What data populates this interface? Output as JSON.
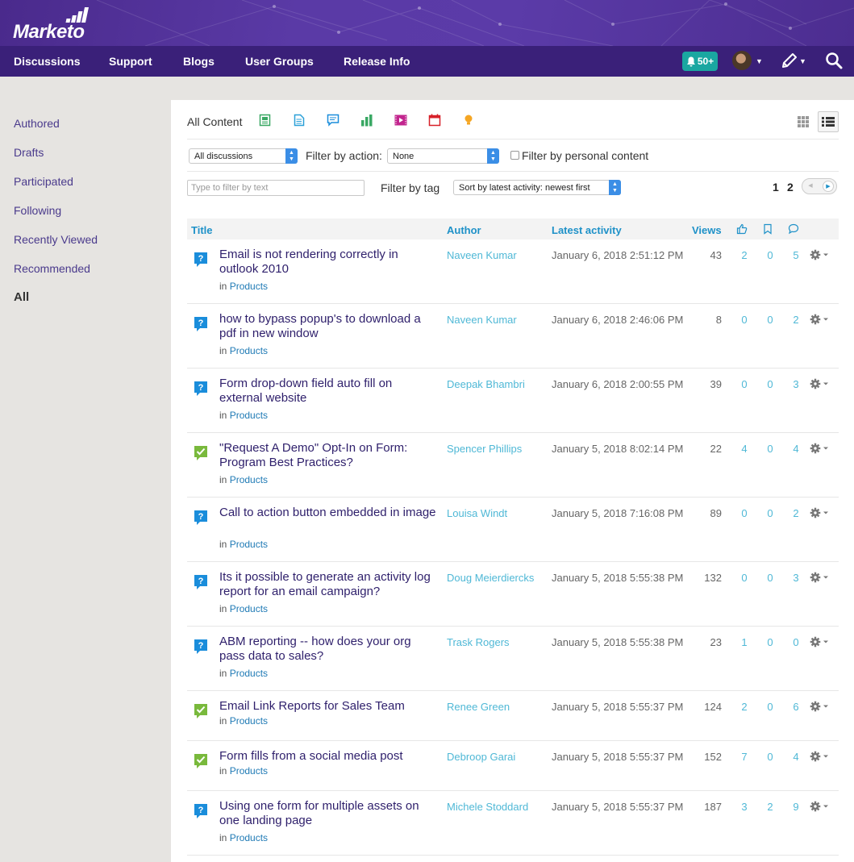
{
  "brand": {
    "logo_text": "Marketo"
  },
  "nav": {
    "items": [
      "Discussions",
      "Support",
      "Blogs",
      "User Groups",
      "Release Info"
    ],
    "notifications": "50+"
  },
  "sidebar": {
    "items": [
      "Authored",
      "Drafts",
      "Participated",
      "Following",
      "Recently Viewed",
      "Recommended",
      "All"
    ],
    "active": "All"
  },
  "content": {
    "label": "All Content",
    "type_icons": [
      "document-icon",
      "file-icon",
      "discussion-icon",
      "poll-icon",
      "video-icon",
      "event-icon",
      "idea-icon"
    ]
  },
  "filters": {
    "discussions_select": "All discussions",
    "action_label": "Filter by action:",
    "action_select": "None",
    "personal_label": "Filter by personal content",
    "text_placeholder": "Type to filter by text",
    "tag_label": "Filter by tag",
    "sort_select": "Sort by latest activity: newest first"
  },
  "pager": {
    "pages": [
      "1",
      "2"
    ]
  },
  "table": {
    "headers": {
      "title": "Title",
      "author": "Author",
      "latest": "Latest activity",
      "views": "Views"
    },
    "rows": [
      {
        "type": "question",
        "title": "Email is not rendering correctly in outlook 2010",
        "place": "Products",
        "author": "Naveen Kumar",
        "latest": "January 6, 2018 2:51:12 PM",
        "views": "43",
        "likes": "2",
        "bookmarks": "0",
        "replies": "5"
      },
      {
        "type": "question",
        "title": "how to bypass popup's to download a pdf in new window",
        "place": "Products",
        "author": "Naveen Kumar",
        "latest": "January 6, 2018 2:46:06 PM",
        "views": "8",
        "likes": "0",
        "bookmarks": "0",
        "replies": "2"
      },
      {
        "type": "question",
        "title": "Form drop-down field auto fill on external website",
        "place": "Products",
        "author": "Deepak Bhambri",
        "latest": "January 6, 2018 2:00:55 PM",
        "views": "39",
        "likes": "0",
        "bookmarks": "0",
        "replies": "3"
      },
      {
        "type": "answered",
        "title": "\"Request A Demo\" Opt-In on Form: Program Best Practices?",
        "place": "Products",
        "author": "Spencer Phillips",
        "latest": "January 5, 2018 8:02:14 PM",
        "views": "22",
        "likes": "4",
        "bookmarks": "0",
        "replies": "4"
      },
      {
        "type": "question",
        "title": "Call to action button embedded in image",
        "place": "Products",
        "author": "Louisa Windt",
        "latest": "January 5, 2018 7:16:08 PM",
        "views": "89",
        "likes": "0",
        "bookmarks": "0",
        "replies": "2"
      },
      {
        "type": "question",
        "title": "Its it possible to generate an activity log report for an email campaign?",
        "place": "Products",
        "author": "Doug Meierdiercks",
        "latest": "January 5, 2018 5:55:38 PM",
        "views": "132",
        "likes": "0",
        "bookmarks": "0",
        "replies": "3"
      },
      {
        "type": "question",
        "title": "ABM reporting -- how does your org pass data to sales?",
        "place": "Products",
        "author": "Trask Rogers",
        "latest": "January 5, 2018 5:55:38 PM",
        "views": "23",
        "likes": "1",
        "bookmarks": "0",
        "replies": "0"
      },
      {
        "type": "answered",
        "title": "Email Link Reports for Sales Team",
        "place": "Products",
        "author": "Renee Green",
        "latest": "January 5, 2018 5:55:37 PM",
        "views": "124",
        "likes": "2",
        "bookmarks": "0",
        "replies": "6"
      },
      {
        "type": "answered",
        "title": "Form fills from a social media post",
        "place": "Products",
        "author": "Debroop Garai",
        "latest": "January 5, 2018 5:55:37 PM",
        "views": "152",
        "likes": "7",
        "bookmarks": "0",
        "replies": "4"
      },
      {
        "type": "question",
        "title": "Using one form for multiple assets on one landing page",
        "place": "Products",
        "author": "Michele Stoddard",
        "latest": "January 5, 2018 5:55:37 PM",
        "views": "187",
        "likes": "3",
        "bookmarks": "2",
        "replies": "9"
      }
    ]
  },
  "colors": {
    "brand_purple": "#4a2a8c",
    "nav_purple": "#3a2079",
    "teal": "#1aa7a1",
    "link_blue": "#1e91c8",
    "author_teal": "#4fb8d6",
    "question_blue": "#1a8ddb",
    "answered_green": "#79b93c"
  }
}
